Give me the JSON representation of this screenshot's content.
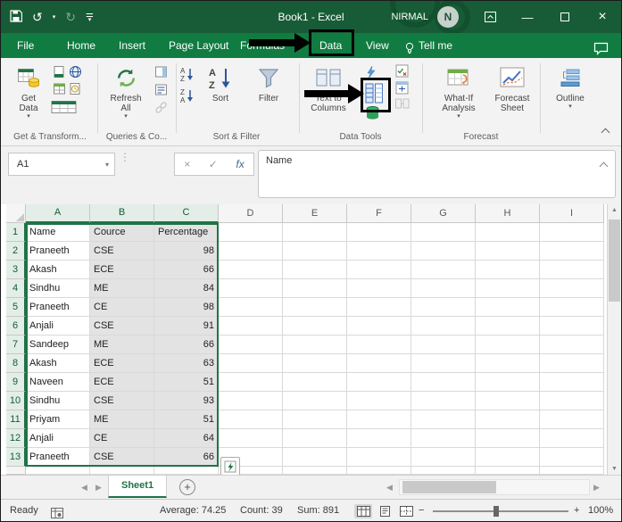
{
  "icons": {
    "dropdown": "▾",
    "undo": "↺",
    "redo": "↻",
    "minimize": "—",
    "close": "×",
    "cancel": "×",
    "enter": "✓",
    "fx": "fx",
    "dots": "⋮",
    "up": "▲",
    "down": "▼",
    "left": "◀",
    "right": "▶",
    "add": "+",
    "minus": "−",
    "plus": "+"
  },
  "titlebar": {
    "title": "Book1 - Excel",
    "user": "NIRMAL",
    "avatar": "N"
  },
  "tabs": {
    "file": "File",
    "home": "Home",
    "insert": "Insert",
    "page_layout": "Page Layout",
    "formulas": "Formulas",
    "data": "Data",
    "view": "View",
    "tell_me": "Tell me"
  },
  "ribbon": {
    "get_data": "Get\nData",
    "refresh_all": "Refresh\nAll",
    "sort": "Sort",
    "filter": "Filter",
    "text_to_columns": "Text to\nColumns",
    "what_if": "What-If\nAnalysis",
    "forecast_sheet": "Forecast\nSheet",
    "outline": "Outline",
    "groups": [
      "Get & Transform...",
      "Queries & Co...",
      "Sort & Filter",
      "Data Tools",
      "Forecast"
    ]
  },
  "formula_bar": {
    "name_box": "A1",
    "value": "Name"
  },
  "sheet": {
    "columns": [
      "A",
      "B",
      "C",
      "D",
      "E",
      "F",
      "G",
      "H",
      "I"
    ],
    "selected_columns": [
      "A",
      "B",
      "C"
    ],
    "active_cell": "A1",
    "rows": [
      {
        "n": "1",
        "a": "Name",
        "b": "Cource",
        "c": "Percentage"
      },
      {
        "n": "2",
        "a": "Praneeth",
        "b": "CSE",
        "c": "98"
      },
      {
        "n": "3",
        "a": "Akash",
        "b": "ECE",
        "c": "66"
      },
      {
        "n": "4",
        "a": "Sindhu",
        "b": "ME",
        "c": "84"
      },
      {
        "n": "5",
        "a": "Praneeth",
        "b": "CE",
        "c": "98"
      },
      {
        "n": "6",
        "a": "Anjali",
        "b": "CSE",
        "c": "91"
      },
      {
        "n": "7",
        "a": "Sandeep",
        "b": "ME",
        "c": "66"
      },
      {
        "n": "8",
        "a": "Akash",
        "b": "ECE",
        "c": "63"
      },
      {
        "n": "9",
        "a": "Naveen",
        "b": "ECE",
        "c": "51"
      },
      {
        "n": "10",
        "a": "Sindhu",
        "b": "CSE",
        "c": "93"
      },
      {
        "n": "11",
        "a": "Priyam",
        "b": "ME",
        "c": "51"
      },
      {
        "n": "12",
        "a": "Anjali",
        "b": "CE",
        "c": "64"
      },
      {
        "n": "13",
        "a": "Praneeth",
        "b": "CSE",
        "c": "66"
      }
    ]
  },
  "sheet_tabs": {
    "sheet1": "Sheet1"
  },
  "status": {
    "mode": "Ready",
    "average": "Average: 74.25",
    "count": "Count: 39",
    "sum": "Sum: 891",
    "zoom": "100%"
  }
}
